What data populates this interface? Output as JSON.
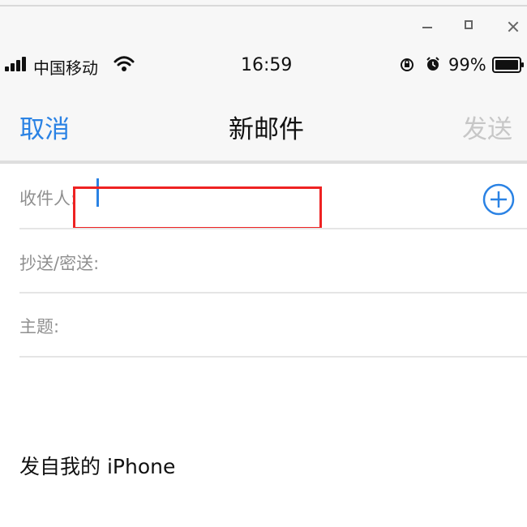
{
  "window": {
    "buttons": [
      "minimize",
      "maximize",
      "close"
    ]
  },
  "status_bar": {
    "carrier": "中国移动",
    "time": "16:59",
    "battery_percent": "99%",
    "icons": [
      "signal-icon",
      "wifi-icon",
      "orientation-lock-icon",
      "alarm-icon",
      "battery-icon"
    ]
  },
  "nav": {
    "cancel_label": "取消",
    "title": "新邮件",
    "send_label": "发送"
  },
  "fields": {
    "to_label": "收件人:",
    "to_value": "",
    "cc_label": "抄送/密送:",
    "cc_value": "",
    "subject_label": "主题:",
    "subject_value": ""
  },
  "body": {
    "signature": "发自我的 iPhone"
  },
  "colors": {
    "accent": "#2a82e4",
    "disabled": "#c7c7c7",
    "highlight": "#ee2222"
  }
}
